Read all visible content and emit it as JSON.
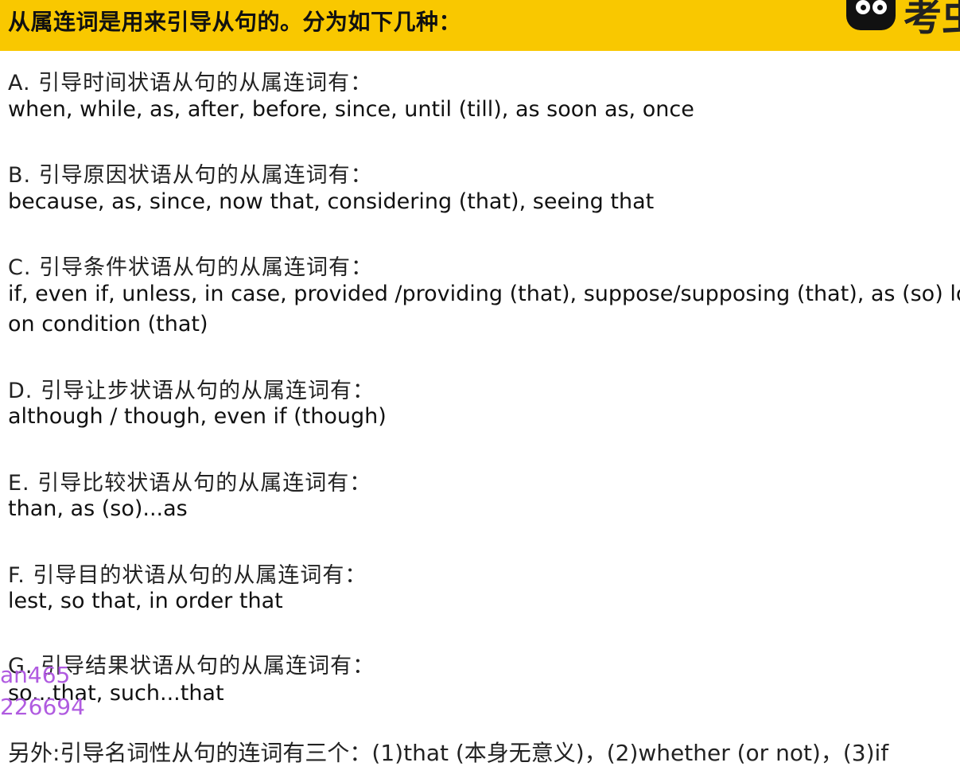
{
  "header": {
    "title": "从属连词是用来引导从句的。分为如下几种：",
    "logo_text": "考虫",
    "accent_color": "#f9c800"
  },
  "sections": [
    {
      "heading": "A. 引导时间状语从句的从属连词有：",
      "lines": [
        "when, while, as, after, before, since, until (till), as soon as, once"
      ]
    },
    {
      "heading": "B. 引导原因状语从句的从属连词有：",
      "lines": [
        "because, as, since, now that, considering (that), seeing that"
      ]
    },
    {
      "heading": "C. 引导条件状语从句的从属连词有：",
      "lines": [
        "if, even if, unless, in case, provided /providing (that), suppose/supposing (that), as (so) long",
        "on condition (that)"
      ]
    },
    {
      "heading": "D. 引导让步状语从句的从属连词有：",
      "lines": [
        "although / though, even if (though)"
      ]
    },
    {
      "heading": "E. 引导比较状语从句的从属连词有：",
      "lines": [
        "than, as (so)...as"
      ]
    },
    {
      "heading": "F. 引导目的状语从句的从属连词有：",
      "lines": [
        "lest, so that, in order that"
      ]
    },
    {
      "heading": "G. 引导结果状语从句的从属连词有：",
      "lines": [
        "so...that, such...that"
      ]
    }
  ],
  "footer": {
    "note": "另外:引导名词性从句的连词有三个：(1)that (本身无意义)，(2)whether (or not)，(3)if"
  },
  "watermark": {
    "line1": "an465",
    "line2": "226694",
    "color": "#b05be0"
  }
}
